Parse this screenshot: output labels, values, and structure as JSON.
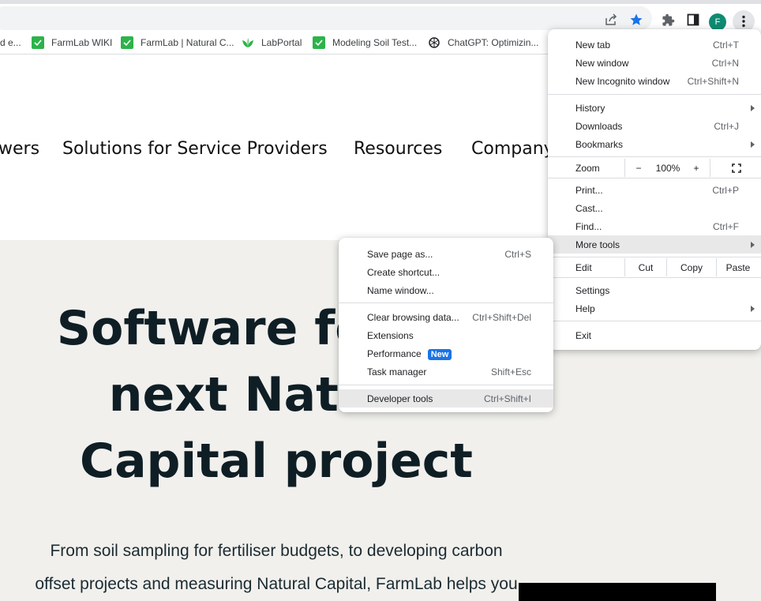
{
  "toolbar": {
    "icons": [
      "share-icon",
      "bookmark-star-icon",
      "extensions-puzzle-icon",
      "side-panel-icon",
      "profile-avatar",
      "chrome-menu-kebab-icon"
    ],
    "avatar_letter": "F",
    "accent_color": "#1a73e8"
  },
  "bookmarks": [
    {
      "label": "d e...",
      "icon": "partial"
    },
    {
      "label": "FarmLab WIKI",
      "icon": "farmlab-green-icon"
    },
    {
      "label": "FarmLab | Natural C...",
      "icon": "farmlab-green-icon"
    },
    {
      "label": "LabPortal",
      "icon": "labportal-leaf-icon"
    },
    {
      "label": "Modeling Soil Test...",
      "icon": "farmlab-green-icon"
    },
    {
      "label": "ChatGPT: Optimizin...",
      "icon": "chatgpt-icon"
    }
  ],
  "page": {
    "nav": [
      "wers",
      "Solutions for Service Providers",
      "Resources",
      "Company"
    ],
    "hero_title_lines": [
      "Software for the",
      "next Natural",
      "Capital project"
    ],
    "hero_text_lines": [
      "From soil sampling for fertiliser budgets, to developing carbon",
      "offset projects and measuring Natural Capital, FarmLab helps you"
    ]
  },
  "chrome_menu": {
    "items": {
      "new_tab": {
        "label": "New tab",
        "shortcut": "Ctrl+T"
      },
      "new_window": {
        "label": "New window",
        "shortcut": "Ctrl+N"
      },
      "new_incognito": {
        "label": "New Incognito window",
        "shortcut": "Ctrl+Shift+N"
      },
      "history": {
        "label": "History"
      },
      "downloads": {
        "label": "Downloads",
        "shortcut": "Ctrl+J"
      },
      "bookmarks": {
        "label": "Bookmarks"
      },
      "print": {
        "label": "Print...",
        "shortcut": "Ctrl+P"
      },
      "cast": {
        "label": "Cast..."
      },
      "find": {
        "label": "Find...",
        "shortcut": "Ctrl+F"
      },
      "more_tools": {
        "label": "More tools"
      },
      "settings": {
        "label": "Settings"
      },
      "help": {
        "label": "Help"
      },
      "exit": {
        "label": "Exit"
      }
    },
    "zoom": {
      "label": "Zoom",
      "minus": "−",
      "value": "100%",
      "plus": "+"
    },
    "edit": {
      "label": "Edit",
      "cut": "Cut",
      "copy": "Copy",
      "paste": "Paste"
    }
  },
  "more_tools_menu": {
    "save_page": {
      "label": "Save page as...",
      "shortcut": "Ctrl+S"
    },
    "create_shortcut": {
      "label": "Create shortcut..."
    },
    "name_window": {
      "label": "Name window..."
    },
    "clear_browsing": {
      "label": "Clear browsing data...",
      "shortcut": "Ctrl+Shift+Del"
    },
    "extensions": {
      "label": "Extensions"
    },
    "performance": {
      "label": "Performance",
      "badge": "New"
    },
    "task_manager": {
      "label": "Task manager",
      "shortcut": "Shift+Esc"
    },
    "developer_tools": {
      "label": "Developer tools",
      "shortcut": "Ctrl+Shift+I"
    }
  }
}
